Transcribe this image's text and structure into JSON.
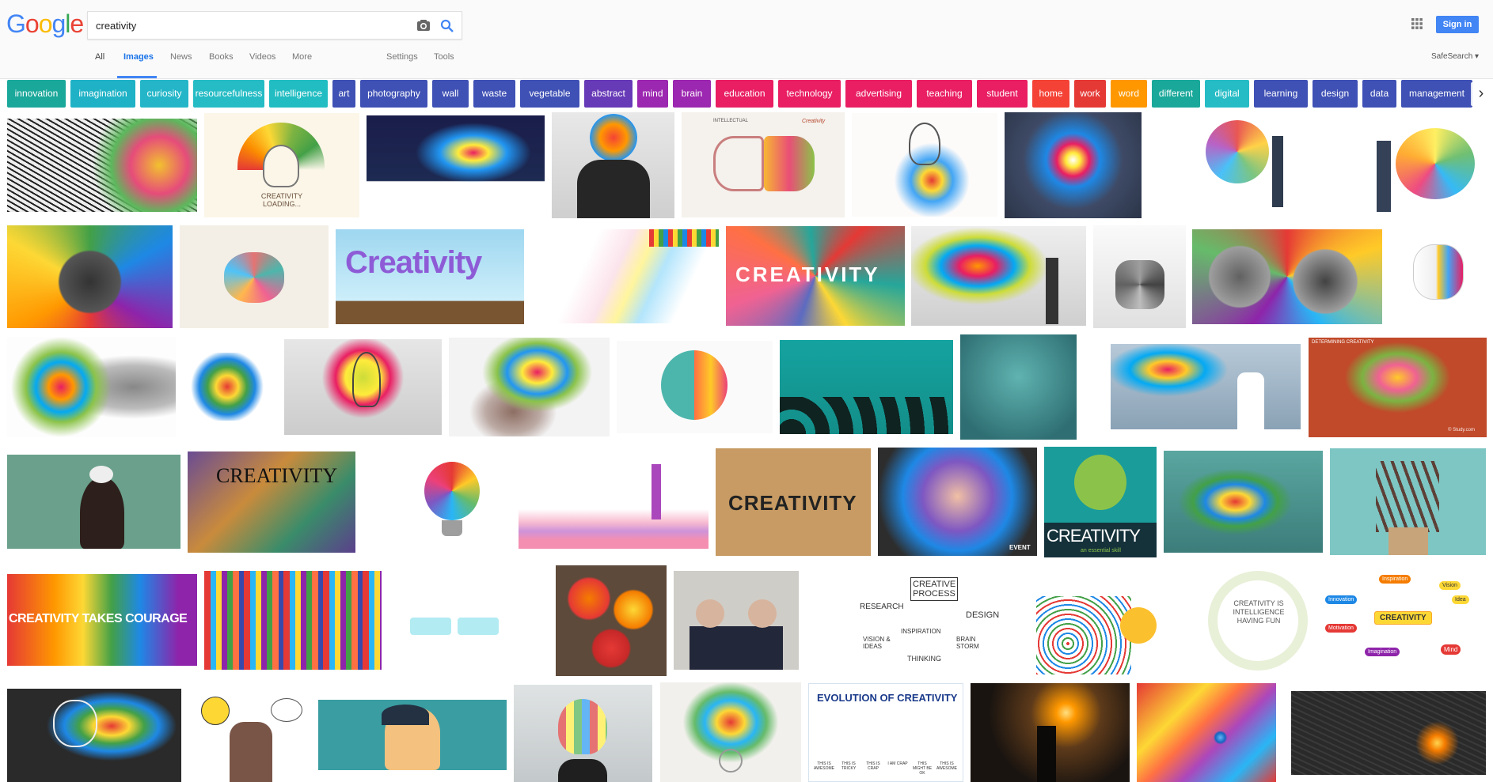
{
  "logo": {
    "letters": [
      "G",
      "o",
      "o",
      "g",
      "l",
      "e"
    ],
    "colors": [
      "#4285f4",
      "#ea4335",
      "#fbbc05",
      "#4285f4",
      "#34a853",
      "#ea4335"
    ]
  },
  "search": {
    "query": "creativity",
    "camera_icon": "camera-icon",
    "search_icon": "search-icon"
  },
  "tabs": [
    "All",
    "Images",
    "News",
    "Books",
    "Videos",
    "More",
    "Settings",
    "Tools"
  ],
  "active_tab": "Images",
  "header_right": {
    "apps_icon": "apps-grid-icon",
    "signin_label": "Sign in",
    "safesearch_label": "SafeSearch ▾"
  },
  "accent_color": "#4285f4",
  "chips": [
    {
      "label": "innovation",
      "color": "#1aa89a"
    },
    {
      "label": "imagination",
      "color": "#1fb2c6"
    },
    {
      "label": "curiosity",
      "color": "#24b6c8"
    },
    {
      "label": "resourcefulness",
      "color": "#26bcc5"
    },
    {
      "label": "intelligence",
      "color": "#22bdc2"
    },
    {
      "label": "art",
      "color": "#3f51b5"
    },
    {
      "label": "photography",
      "color": "#3f51b5"
    },
    {
      "label": "wall",
      "color": "#3f51b5"
    },
    {
      "label": "waste",
      "color": "#3f51b5"
    },
    {
      "label": "vegetable",
      "color": "#3f51b5"
    },
    {
      "label": "abstract",
      "color": "#673ab7"
    },
    {
      "label": "mind",
      "color": "#9c27b0"
    },
    {
      "label": "brain",
      "color": "#9c27b0"
    },
    {
      "label": "education",
      "color": "#e91e63"
    },
    {
      "label": "technology",
      "color": "#e91e63"
    },
    {
      "label": "advertising",
      "color": "#e91e63"
    },
    {
      "label": "teaching",
      "color": "#e91e63"
    },
    {
      "label": "student",
      "color": "#e91e63"
    },
    {
      "label": "home",
      "color": "#f44336"
    },
    {
      "label": "work",
      "color": "#e53935"
    },
    {
      "label": "word",
      "color": "#ff9800"
    },
    {
      "label": "different",
      "color": "#1aa89a"
    },
    {
      "label": "digital",
      "color": "#26bcc5"
    },
    {
      "label": "learning",
      "color": "#3f51b5"
    },
    {
      "label": "design",
      "color": "#3f51b5"
    },
    {
      "label": "data",
      "color": "#3f51b5"
    },
    {
      "label": "management",
      "color": "#3f51b5"
    }
  ],
  "chips_next_icon": "chevron-right-icon",
  "image_texts": {
    "creativity_loading": "CREATIVITY LOADING...",
    "intellectual": "INTELLECTUAL",
    "creativity_script": "Creativity",
    "creativity_plants": "Creativity",
    "creativity_blocks": "CREATIVITY",
    "determining": "DETERMINING CREATIVITY",
    "study_com": "© Study.com",
    "creativity_title": "CREATIVITY",
    "creativity_cutout": "CREATIVITY",
    "event": "EVENT",
    "creativity_green": "CREATIVITY",
    "creativity_green_sub": "an essential skill",
    "creativity_takes": "CREATIVITY TAKES COURAGE",
    "creative_process": "CREATIVE PROCESS",
    "research": "RESEARCH",
    "design": "DESIGN",
    "vision_ideas": "VISION & IDEAS",
    "inspiration": "INSPIRATION",
    "thinking": "THINKING",
    "brainstorm": "BRAIN STORM",
    "creativity_fun": "CREATIVITY IS INTELLIGENCE HAVING FUN",
    "mindmap_center": "CREATIVITY",
    "mindmap_nodes": [
      "Inspiration",
      "Vision",
      "Idea",
      "Innovation",
      "Motivation",
      "Imagination",
      "Mind"
    ],
    "evolution": "EVOLUTION OF CREATIVITY",
    "evolution_labels": [
      "THIS IS AWESOME",
      "THIS IS TRICKY",
      "THIS IS CRAP",
      "I AM CRAP",
      "THIS MIGHT BE OK",
      "THIS IS AWESOME"
    ]
  }
}
